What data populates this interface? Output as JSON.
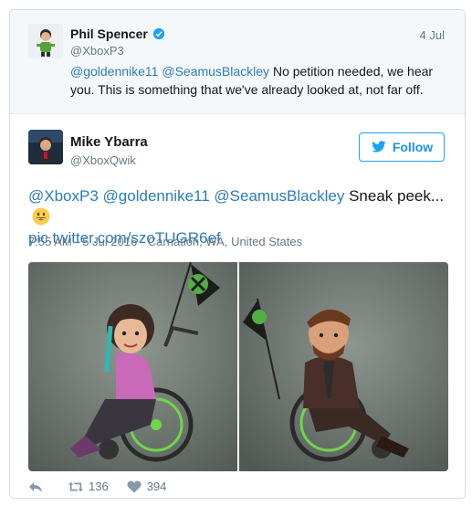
{
  "parent_tweet": {
    "name": "Phil Spencer",
    "handle": "@XboxP3",
    "date": "4 Jul",
    "mentions": [
      "@goldennike11",
      "@SeamusBlackley"
    ],
    "text": "No petition needed, we hear you. This is something that we've already looked at, not far off."
  },
  "tweet": {
    "name": "Mike Ybarra",
    "handle": "@XboxQwik",
    "follow_label": "Follow",
    "mentions": [
      "@XboxP3",
      "@goldennike11",
      "@SeamusBlackley"
    ],
    "text": "Sneak peek...",
    "link": "pic.twitter.com/szoTUGR6ef",
    "meta": "7:55 AM - 5 Jul 2016 · Carnation, WA, United States",
    "retweets": "136",
    "likes": "394"
  },
  "icons": {
    "verified": "verified-badge-icon",
    "follow": "follow-bird-icon",
    "emoji": "grinning-face-emoji",
    "reply": "reply-icon",
    "retweet": "retweet-icon",
    "like": "heart-icon"
  },
  "colors": {
    "link": "#2b7bb9",
    "follow_blue": "#1da1f2",
    "muted": "#657786",
    "xbox_green": "#52b043"
  }
}
